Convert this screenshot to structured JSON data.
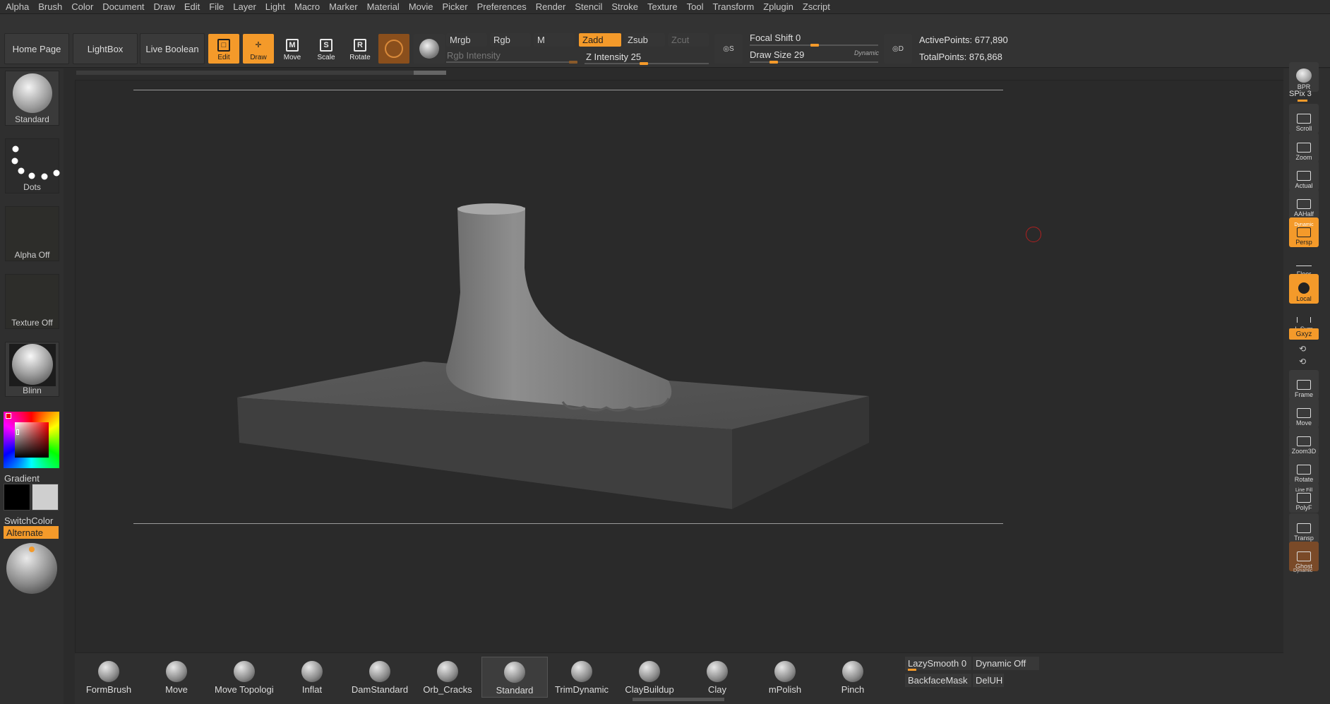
{
  "menu": [
    "Alpha",
    "Brush",
    "Color",
    "Document",
    "Draw",
    "Edit",
    "File",
    "Layer",
    "Light",
    "Macro",
    "Marker",
    "Material",
    "Movie",
    "Picker",
    "Preferences",
    "Render",
    "Stencil",
    "Stroke",
    "Texture",
    "Tool",
    "Transform",
    "Zplugin",
    "Zscript"
  ],
  "toolbar": {
    "home_page": "Home Page",
    "lightbox": "LightBox",
    "live_boolean": "Live Boolean",
    "tools": {
      "edit": "Edit",
      "draw": "Draw",
      "move": "Move",
      "scale": "Scale",
      "rotate": "Rotate"
    },
    "modes": {
      "mrgb": "Mrgb",
      "rgb": "Rgb",
      "m": "M",
      "zadd": "Zadd",
      "zsub": "Zsub",
      "zcut": "Zcut"
    },
    "rgb_intensity": "Rgb Intensity",
    "z_intensity_label": "Z Intensity",
    "z_intensity_value": "25",
    "focal_shift_label": "Focal Shift",
    "focal_shift_value": "0",
    "draw_size_label": "Draw Size",
    "draw_size_value": "29",
    "dynamic": "Dynamic",
    "active_points": "ActivePoints: 677,890",
    "total_points": "TotalPoints: 876,868"
  },
  "left": {
    "brush": "Standard",
    "stroke": "Dots",
    "alpha": "Alpha Off",
    "texture": "Texture Off",
    "material": "Blinn",
    "gradient": "Gradient",
    "switch_color": "SwitchColor",
    "alternate": "Alternate"
  },
  "right": {
    "bpr": "BPR",
    "spix": "SPix 3",
    "scroll": "Scroll",
    "zoom": "Zoom",
    "actual": "Actual",
    "aahalf": "AAHalf",
    "dynamic_label": "Dynamic",
    "persp": "Persp",
    "floor": "Floor",
    "local": "Local",
    "lsym": "L.Sym",
    "xyz": "Gxyz",
    "frame": "Frame",
    "move": "Move",
    "zoom3d": "Zoom3D",
    "rotate": "Rotate",
    "line_fill": "Line Fill",
    "polyf": "PolyF",
    "transp": "Transp",
    "ghost": "Ghost",
    "dynamic_bottom": "Dynamic"
  },
  "brushes": [
    "FormBrush",
    "Move",
    "Move Topologica",
    "Inflat",
    "DamStandard",
    "Orb_Cracks",
    "Standard",
    "TrimDynamic",
    "ClayBuildup",
    "Clay",
    "mPolish",
    "Pinch"
  ],
  "bottom": {
    "lazysmooth": "LazySmooth 0",
    "dynamic_off": "Dynamic Off",
    "backface_mask": "BackfaceMask",
    "deluh": "DelUH"
  },
  "colors": {
    "accent": "#f49a2a",
    "panel": "#333333",
    "canvas": "#2a2a2a"
  }
}
